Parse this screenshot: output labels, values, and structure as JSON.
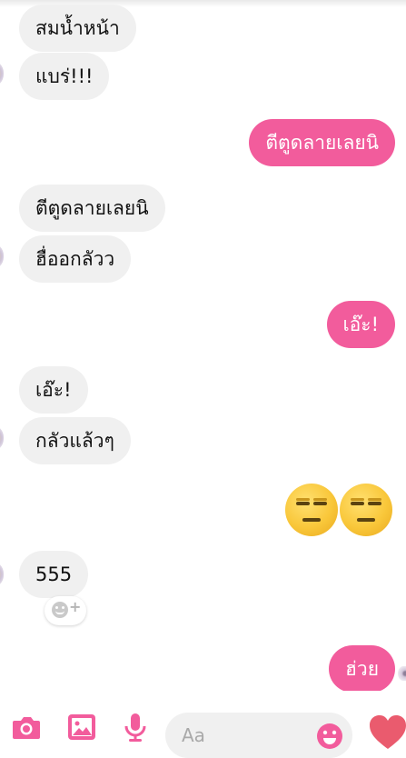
{
  "messages": [
    {
      "side": "in",
      "text": "สมน้ำหน้า"
    },
    {
      "side": "in",
      "text": "แบร่!!!"
    },
    {
      "side": "out",
      "text": "ตีตูดลายเลยนิ"
    },
    {
      "side": "in",
      "text": "ตีตูดลายเลยนิ"
    },
    {
      "side": "in",
      "text": "ฮื่ออกลัวว"
    },
    {
      "side": "out",
      "text": "เอ๊ะ!"
    },
    {
      "side": "in",
      "text": "เอ๊ะ!"
    },
    {
      "side": "in",
      "text": "กลัวแล้วๆ"
    },
    {
      "side": "out",
      "emoji": "expressionless-face"
    },
    {
      "side": "in",
      "text": "555"
    },
    {
      "side": "out",
      "text": "ฮ่วย"
    }
  ],
  "composer": {
    "placeholder": "Aa",
    "icons": [
      "camera-icon",
      "gallery-icon",
      "microphone-icon",
      "smile-icon",
      "heart-icon"
    ]
  },
  "colors": {
    "accent": "#f25c9c",
    "incoming_bubble": "#f0f0f0",
    "heart": "#ea5b6e"
  }
}
